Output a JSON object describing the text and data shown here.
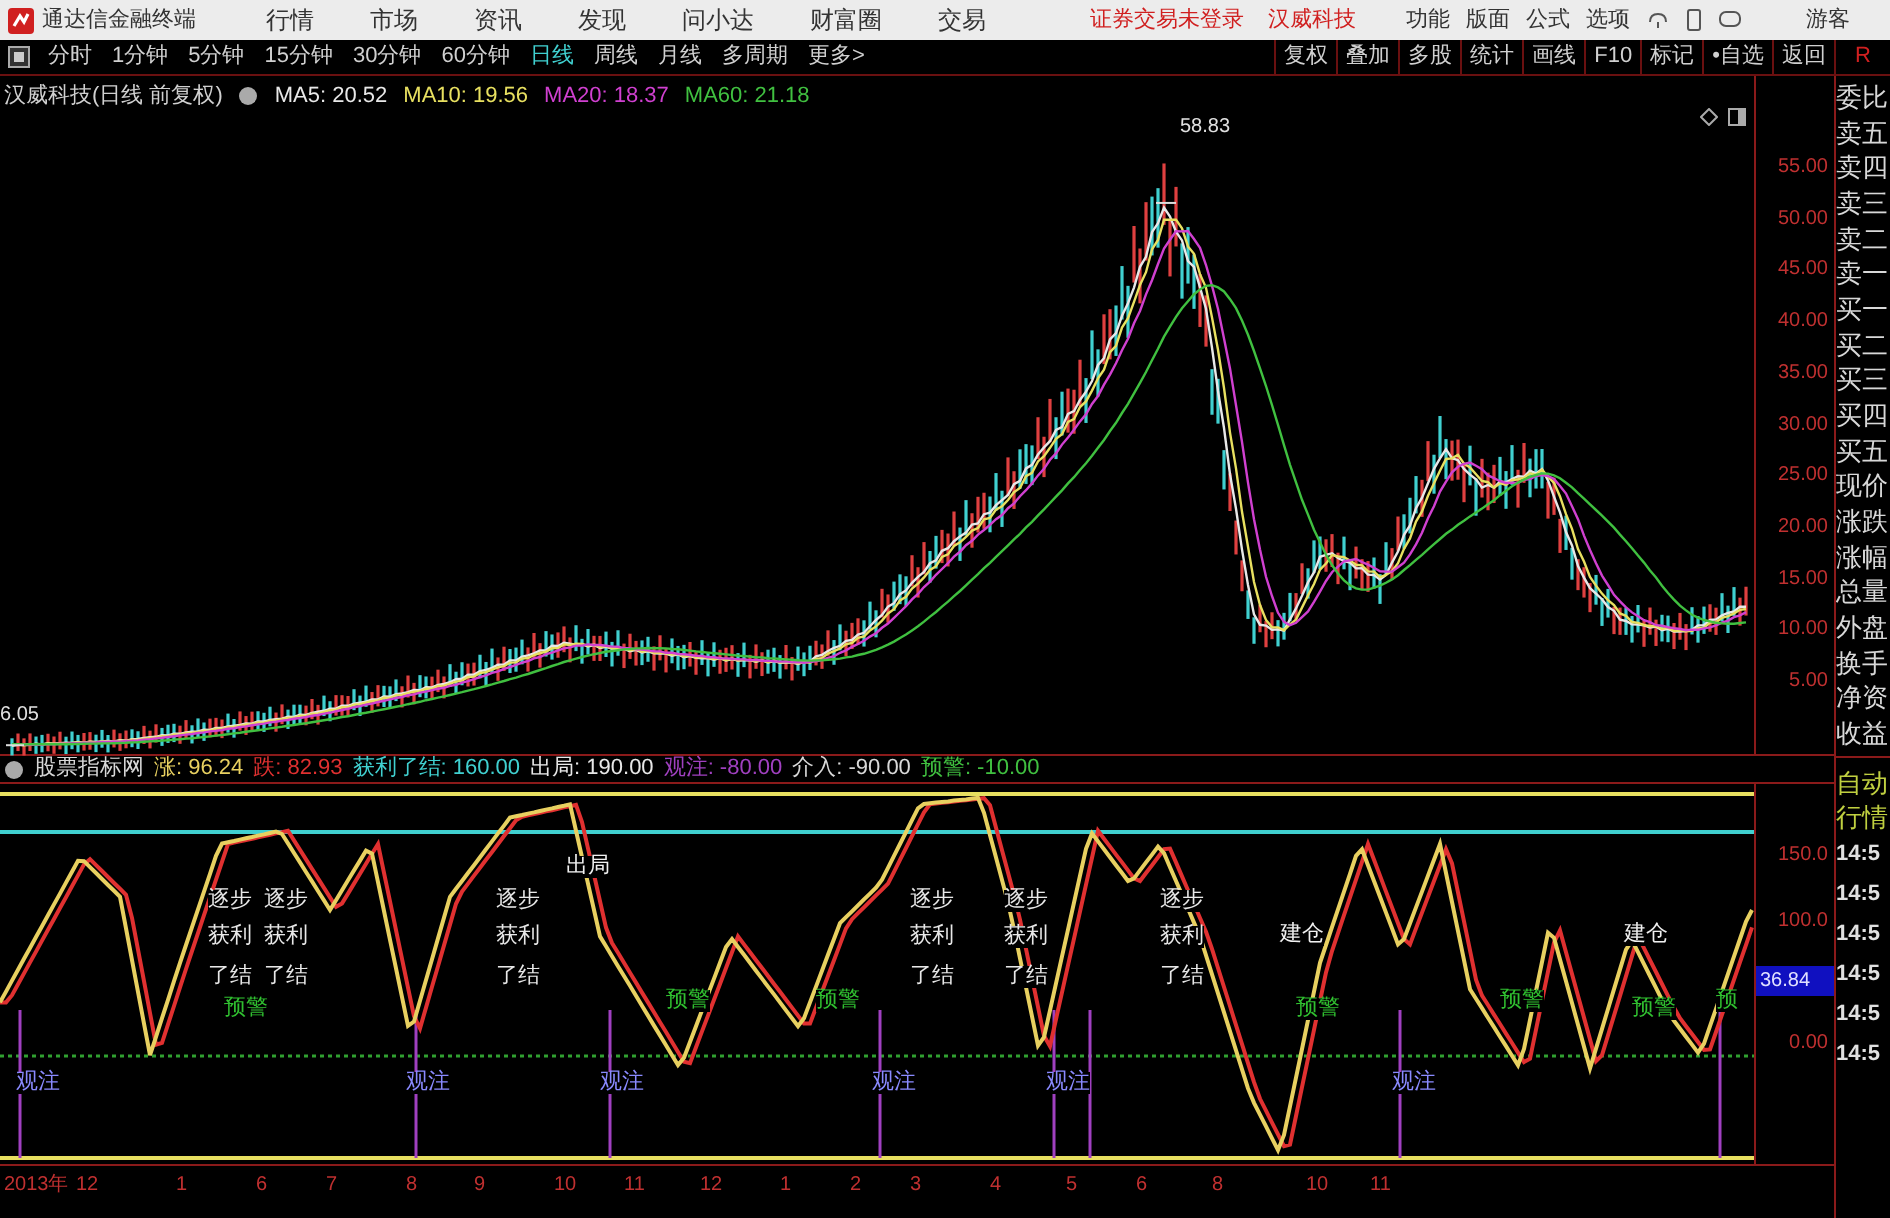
{
  "app": {
    "title": "通达信金融终端",
    "menu": [
      "行情",
      "市场",
      "资讯",
      "发现",
      "问小达",
      "财富圈",
      "交易"
    ],
    "login_notice": "证券交易未登录",
    "stock_name": "汉威科技",
    "right_menu": [
      "功能",
      "版面",
      "公式",
      "选项"
    ],
    "user": "游客"
  },
  "periods": [
    {
      "label": "分时",
      "selected": false
    },
    {
      "label": "1分钟",
      "selected": false
    },
    {
      "label": "5分钟",
      "selected": false
    },
    {
      "label": "15分钟",
      "selected": false
    },
    {
      "label": "30分钟",
      "selected": false
    },
    {
      "label": "60分钟",
      "selected": false
    },
    {
      "label": "日线",
      "selected": true
    },
    {
      "label": "周线",
      "selected": false
    },
    {
      "label": "月线",
      "selected": false
    },
    {
      "label": "多周期",
      "selected": false
    },
    {
      "label": "更多>",
      "selected": false
    }
  ],
  "tools": [
    "复权",
    "叠加",
    "多股",
    "统计",
    "画线",
    "F10",
    "标记",
    "•自选",
    "返回"
  ],
  "corner_label": "R",
  "price_chart": {
    "title": "汉威科技(日线 前复权)",
    "ma": [
      {
        "label": "MA5: 20.52",
        "color": "#e8e8e8"
      },
      {
        "label": "MA10: 19.56",
        "color": "#e8e060"
      },
      {
        "label": "MA20: 18.37",
        "color": "#d040d0"
      },
      {
        "label": "MA60: 21.18",
        "color": "#40c040"
      }
    ],
    "high_label": "58.83",
    "low_label": "6.05",
    "axis": [
      "55.00",
      "50.00",
      "45.00",
      "40.00",
      "35.00",
      "30.00",
      "25.00",
      "20.00",
      "15.00",
      "10.00",
      "5.00"
    ]
  },
  "indicator": {
    "title": "股票指标网",
    "legend": [
      {
        "label": "涨:",
        "value": "96.24",
        "color": "#e8d060"
      },
      {
        "label": "跌:",
        "value": "82.93",
        "color": "#e03030"
      },
      {
        "label": "获利了结:",
        "value": "160.00",
        "color": "#40d0d0"
      },
      {
        "label": "出局:",
        "value": "190.00",
        "color": "#e8e8e8"
      },
      {
        "label": "观注:",
        "value": "-80.00",
        "color": "#a040c0"
      },
      {
        "label": "介入:",
        "value": "-90.00",
        "color": "#d8d8d8"
      },
      {
        "label": "预警:",
        "value": "-10.00",
        "color": "#40c040"
      }
    ],
    "axis": [
      "150.0",
      "100.0",
      "0.00"
    ],
    "current": "36.84",
    "signals": [
      {
        "text": "出局",
        "kind": "exit"
      },
      {
        "text": "逐步",
        "kind": "profit"
      },
      {
        "text": "获利",
        "kind": "profit"
      },
      {
        "text": "了结",
        "kind": "profit"
      },
      {
        "text": "逐步",
        "kind": "profit"
      },
      {
        "text": "获利",
        "kind": "profit"
      },
      {
        "text": "了结",
        "kind": "profit"
      },
      {
        "text": "逐步",
        "kind": "profit"
      },
      {
        "text": "获利",
        "kind": "profit"
      },
      {
        "text": "了结",
        "kind": "profit"
      },
      {
        "text": "逐步",
        "kind": "profit"
      },
      {
        "text": "获利",
        "kind": "profit"
      },
      {
        "text": "了结",
        "kind": "profit"
      },
      {
        "text": "逐步",
        "kind": "profit"
      },
      {
        "text": "获利",
        "kind": "profit"
      },
      {
        "text": "了结",
        "kind": "profit"
      },
      {
        "text": "逐步",
        "kind": "profit"
      },
      {
        "text": "获利",
        "kind": "profit"
      },
      {
        "text": "了结",
        "kind": "profit"
      },
      {
        "text": "建仓",
        "kind": "build"
      },
      {
        "text": "建仓",
        "kind": "build"
      },
      {
        "text": "预警",
        "kind": "warn"
      },
      {
        "text": "预警",
        "kind": "warn"
      },
      {
        "text": "预警",
        "kind": "warn"
      },
      {
        "text": "预警",
        "kind": "warn"
      },
      {
        "text": "预警",
        "kind": "warn"
      },
      {
        "text": "预警",
        "kind": "warn"
      },
      {
        "text": "预",
        "kind": "warn"
      },
      {
        "text": "观注",
        "kind": "watch"
      },
      {
        "text": "观注",
        "kind": "watch"
      },
      {
        "text": "观注",
        "kind": "watch"
      },
      {
        "text": "观注",
        "kind": "watch"
      },
      {
        "text": "观注",
        "kind": "watch"
      },
      {
        "text": "观注",
        "kind": "watch"
      }
    ]
  },
  "x_axis": [
    "2013年",
    "12",
    "1",
    "6",
    "7",
    "8",
    "9",
    "10",
    "11",
    "12",
    "1",
    "2",
    "3",
    "4",
    "5",
    "6",
    "8",
    "10",
    "11"
  ],
  "quote_panel": [
    "委比",
    "卖五",
    "卖四",
    "卖三",
    "卖二",
    "卖一",
    "买一",
    "买二",
    "买三",
    "买四",
    "买五",
    "现价",
    "涨跌",
    "涨幅",
    "总量",
    "外盘",
    "换手",
    "净资",
    "收益"
  ],
  "quote_mode": [
    "自动",
    "行情"
  ],
  "ticks": [
    "14:5",
    "14:5",
    "14:5",
    "14:5",
    "14:5",
    "14:5"
  ]
}
